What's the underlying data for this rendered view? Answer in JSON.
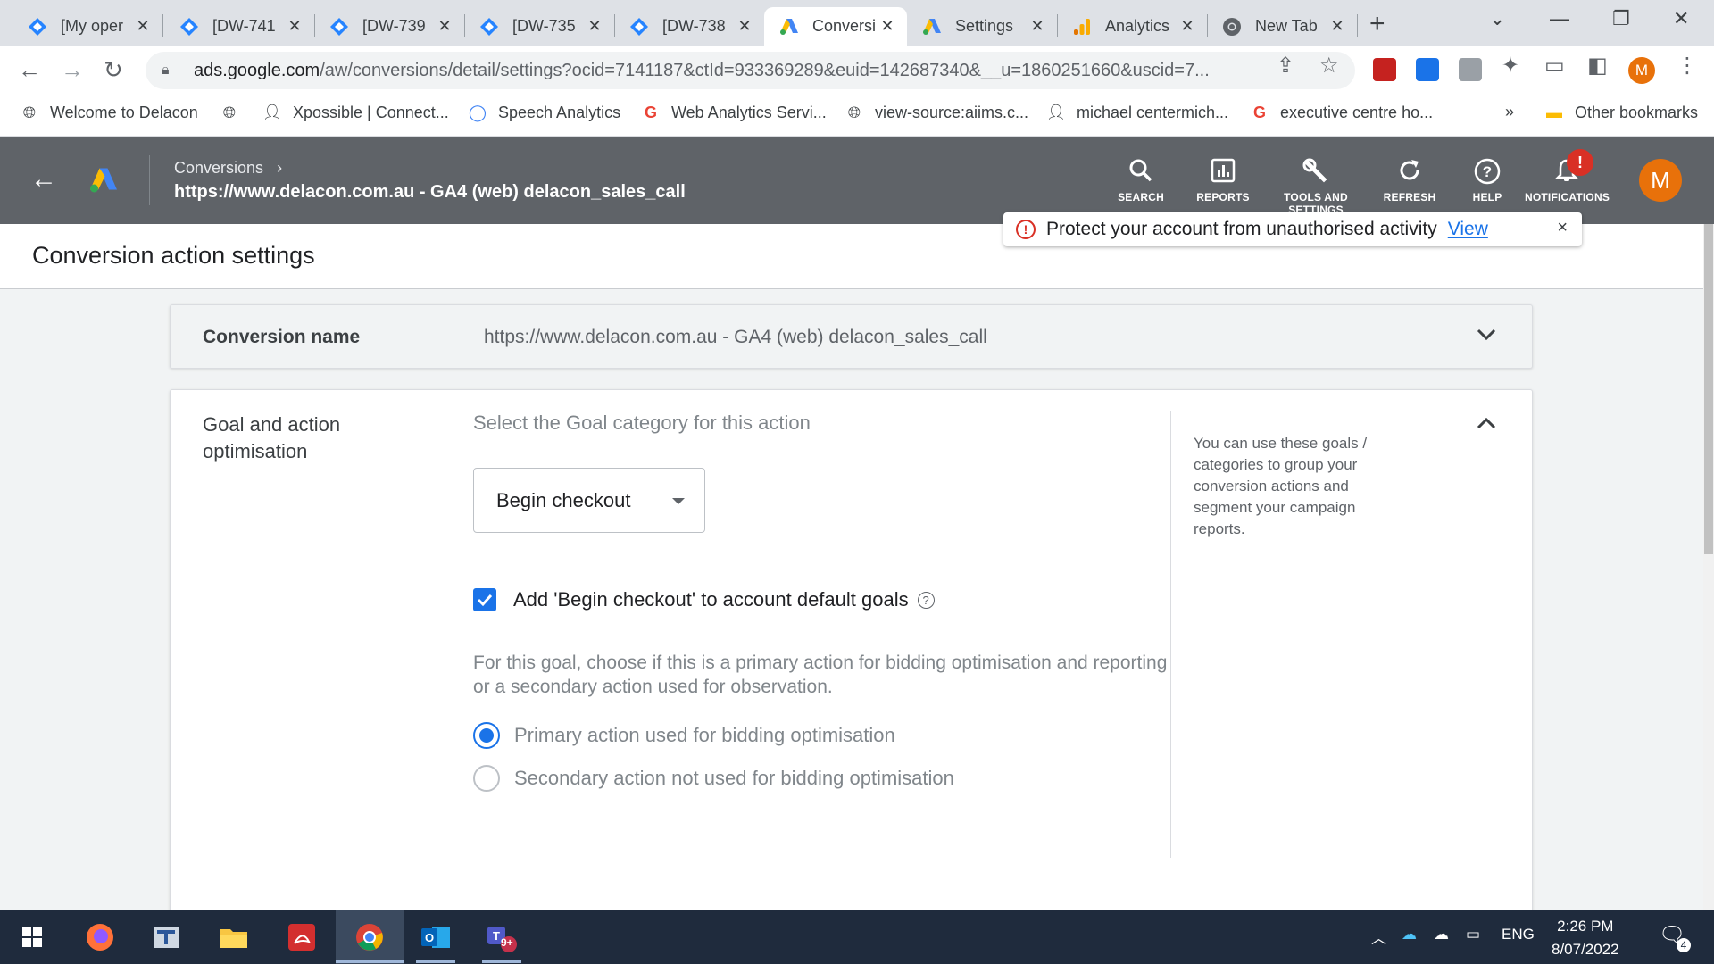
{
  "browser": {
    "tabs": [
      {
        "title": "[My oper",
        "icon": "jira-icon"
      },
      {
        "title": "[DW-741",
        "icon": "jira-icon"
      },
      {
        "title": "[DW-739",
        "icon": "jira-icon"
      },
      {
        "title": "[DW-735",
        "icon": "jira-icon"
      },
      {
        "title": "[DW-738",
        "icon": "jira-icon"
      },
      {
        "title": "Conversi",
        "icon": "google-ads-icon",
        "active": true
      },
      {
        "title": "Settings",
        "icon": "google-ads-icon"
      },
      {
        "title": "Analytics",
        "icon": "analytics-icon"
      },
      {
        "title": "New Tab",
        "icon": "chrome-icon"
      }
    ],
    "url_host": "ads.google.com",
    "url_path": "/aw/conversions/detail/settings?ocid=7141187&ctId=933369289&euid=142687340&__u=1860251660&uscid=7...",
    "profile_initial": "M",
    "bookmarks": [
      {
        "label": "Welcome to Delacon",
        "icon": "globe-icon"
      },
      {
        "label": "",
        "icon": "globe-icon"
      },
      {
        "label": "Xpossible | Connect...",
        "icon": "person-icon"
      },
      {
        "label": "Speech Analytics",
        "icon": "circle-icon"
      },
      {
        "label": "Web Analytics Servi...",
        "icon": "google-icon"
      },
      {
        "label": "view-source:aiims.c...",
        "icon": "globe-icon"
      },
      {
        "label": "michael centermich...",
        "icon": "person-icon"
      },
      {
        "label": "executive centre ho...",
        "icon": "google-icon"
      }
    ],
    "bookmarks_overflow": "»",
    "other_bookmarks": "Other bookmarks"
  },
  "ads_header": {
    "breadcrumb": "Conversions",
    "title": "https://www.delacon.com.au - GA4 (web) delacon_sales_call",
    "buttons": [
      {
        "label": "SEARCH",
        "icon": "search-icon"
      },
      {
        "label": "REPORTS",
        "icon": "reports-icon"
      },
      {
        "label": "TOOLS AND SETTINGS",
        "icon": "wrench-icon"
      },
      {
        "label": "REFRESH",
        "icon": "refresh-icon"
      },
      {
        "label": "HELP",
        "icon": "help-icon"
      },
      {
        "label": "NOTIFICATIONS",
        "icon": "bell-icon"
      }
    ],
    "notification_badge": "!",
    "avatar_initial": "M"
  },
  "alert": {
    "text": "Protect your account from unauthorised activity",
    "link": "View",
    "close": "×"
  },
  "page": {
    "title": "Conversion action settings",
    "conversion_name": {
      "label": "Conversion name",
      "value": "https://www.delacon.com.au - GA4 (web) delacon_sales_call"
    },
    "goal": {
      "label": "Goal and action optimisation",
      "prompt": "Select the Goal category for this action",
      "selected_category": "Begin checkout",
      "checkbox_label": "Add 'Begin checkout' to account default goals",
      "checkbox_checked": true,
      "description": "For this goal, choose if this is a primary action for bidding optimisation and reporting or a secondary action used for observation.",
      "options": [
        {
          "label": "Primary action used for bidding optimisation",
          "selected": true
        },
        {
          "label": "Secondary action not used for bidding optimisation",
          "selected": false
        }
      ],
      "help_text": "You can use these goals / categories to group your conversion actions and segment your campaign reports."
    }
  },
  "taskbar": {
    "apps": [
      "windows-start-icon",
      "firefox-icon",
      "app-icon",
      "file-explorer-icon",
      "acrobat-icon",
      "chrome-icon",
      "outlook-icon",
      "teams-icon"
    ],
    "teams_badge": "9+",
    "language": "ENG",
    "time": "2:26 PM",
    "date": "8/07/2022",
    "notifications_count": "4"
  },
  "colors": {
    "accent": "#1a73e8",
    "ads_header": "#5f6368",
    "alert_red": "#d93025",
    "avatar_orange": "#e8710a"
  }
}
